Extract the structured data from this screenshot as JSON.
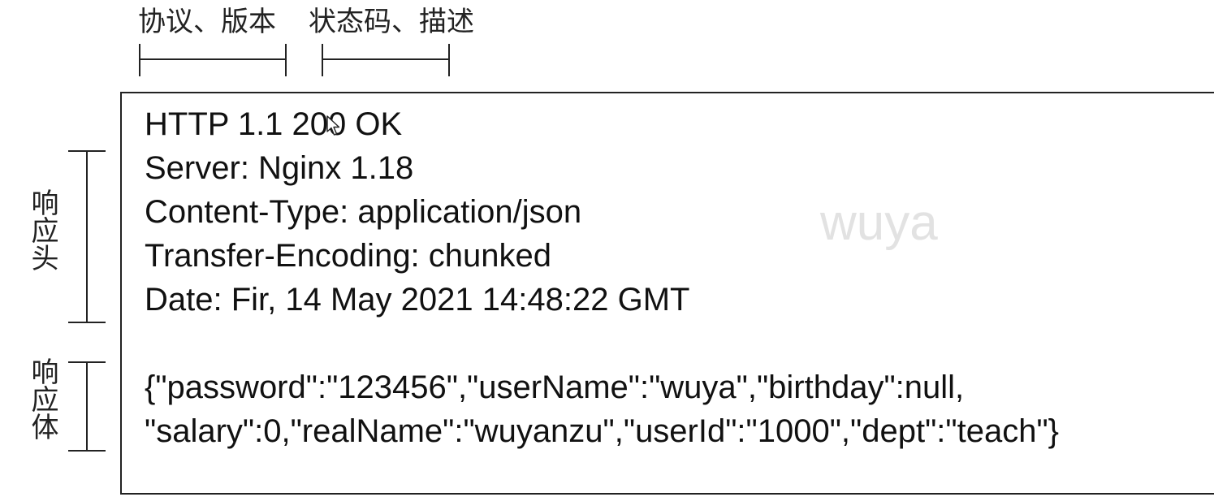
{
  "annotations": {
    "protocol_version": "协议、版本",
    "status_code_desc": "状态码、描述",
    "response_header": "响应头",
    "response_body": "响应体"
  },
  "response": {
    "status_line": "HTTP 1.1 200 OK",
    "headers": [
      "Server: Nginx 1.18",
      "Content-Type: application/json",
      "Transfer-Encoding: chunked",
      "Date: Fir, 14 May 2021 14:48:22 GMT"
    ],
    "body_lines": [
      "{\"password\":\"123456\",\"userName\":\"wuya\",\"birthday\":null,",
      "\"salary\":0,\"realName\":\"wuyanzu\",\"userId\":\"1000\",\"dept\":\"teach\"}"
    ]
  },
  "watermark": "wuya",
  "icons": {
    "cursor": "mouse-pointer-icon"
  }
}
